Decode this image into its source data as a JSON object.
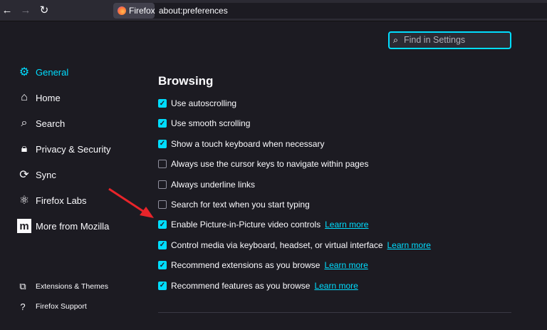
{
  "toolbar": {
    "identity": "Firefox",
    "url": "about:preferences"
  },
  "search": {
    "placeholder": "Find in Settings"
  },
  "sidebar": {
    "items": [
      {
        "label": "General",
        "icon": "gear-icon",
        "active": true
      },
      {
        "label": "Home",
        "icon": "home-icon"
      },
      {
        "label": "Search",
        "icon": "search-icon"
      },
      {
        "label": "Privacy & Security",
        "icon": "lock-icon"
      },
      {
        "label": "Sync",
        "icon": "sync-icon"
      },
      {
        "label": "Firefox Labs",
        "icon": "labs-icon"
      },
      {
        "label": "More from Mozilla",
        "icon": "mozilla-icon"
      }
    ],
    "footer": [
      {
        "label": "Extensions & Themes",
        "icon": "puzzle-icon"
      },
      {
        "label": "Firefox Support",
        "icon": "help-icon"
      }
    ]
  },
  "main": {
    "heading": "Browsing",
    "learn_more": "Learn more",
    "options": [
      {
        "label": "Use autoscrolling",
        "checked": true
      },
      {
        "label": "Use smooth scrolling",
        "checked": true
      },
      {
        "label": "Show a touch keyboard when necessary",
        "checked": true
      },
      {
        "label": "Always use the cursor keys to navigate within pages",
        "checked": false
      },
      {
        "label": "Always underline links",
        "checked": false
      },
      {
        "label": "Search for text when you start typing",
        "checked": false
      },
      {
        "label": "Enable Picture-in-Picture video controls",
        "checked": true,
        "link": true
      },
      {
        "label": "Control media via keyboard, headset, or virtual interface",
        "checked": true,
        "link": true
      },
      {
        "label": "Recommend extensions as you browse",
        "checked": true,
        "link": true
      },
      {
        "label": "Recommend features as you browse",
        "checked": true,
        "link": true
      }
    ]
  },
  "colors": {
    "accent": "#00ddff",
    "background": "#1c1b22",
    "arrow": "#e8242a"
  }
}
